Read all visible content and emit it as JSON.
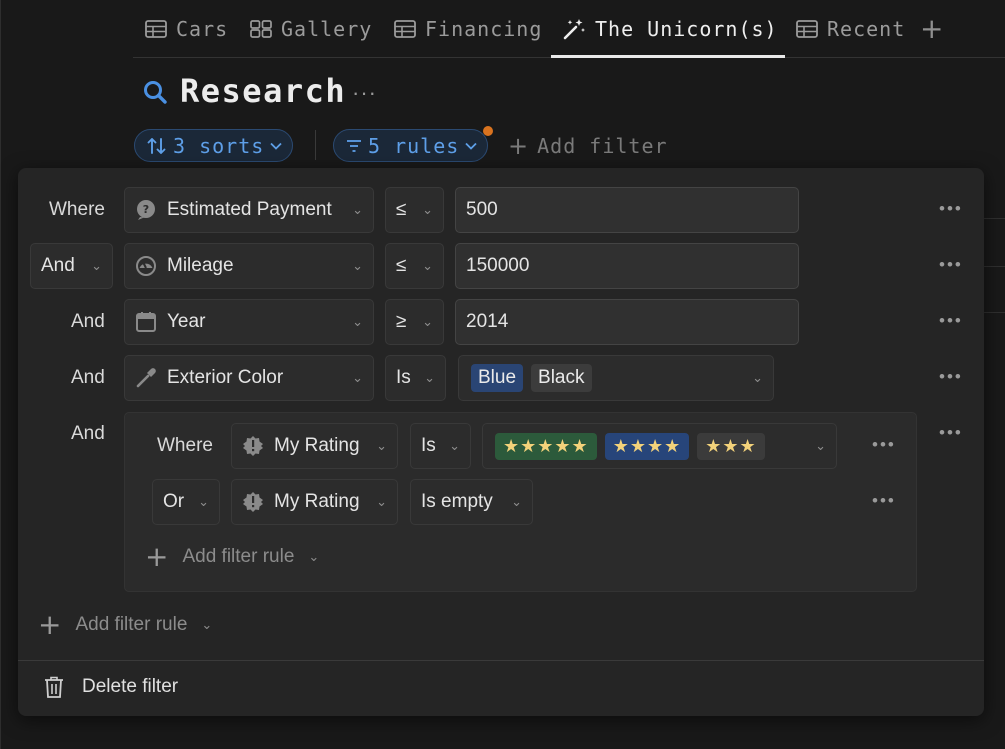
{
  "tabs": [
    {
      "label": "Cars",
      "icon": "table-icon"
    },
    {
      "label": "Gallery",
      "icon": "gallery-icon"
    },
    {
      "label": "Financing",
      "icon": "table-icon"
    },
    {
      "label": "The Unicorn(s)",
      "icon": "magic-wand-icon",
      "active": true
    },
    {
      "label": "Recent",
      "icon": "table-icon"
    }
  ],
  "tab_add": "+",
  "page": {
    "title": "Research",
    "more": "···"
  },
  "toolbar": {
    "sorts_label": "3 sorts",
    "rules_label": "5 rules",
    "add_filter_label": "Add filter"
  },
  "filter": {
    "rows": [
      {
        "conj": "Where",
        "property": "Estimated Payment",
        "operator": "≤",
        "value": "500"
      },
      {
        "conj": "And",
        "property": "Mileage",
        "operator": "≤",
        "value": "150000"
      },
      {
        "conj": "And",
        "property": "Year",
        "operator": "≥",
        "value": "2014"
      },
      {
        "conj": "And",
        "property": "Exterior Color",
        "operator": "Is",
        "tags": [
          "Blue",
          "Black"
        ]
      },
      {
        "conj": "And"
      }
    ],
    "group": {
      "rows": [
        {
          "conj": "Where",
          "property": "My Rating",
          "operator": "Is",
          "stars": [
            "★★★★★",
            "★★★★",
            "★★★"
          ]
        },
        {
          "conj": "Or",
          "property": "My Rating",
          "operator": "Is empty"
        }
      ],
      "add_rule_label": "Add filter rule"
    },
    "add_rule_label": "Add filter rule",
    "delete_label": "Delete filter"
  },
  "colors": {
    "accent": "#5e9fe8",
    "dot": "#d9731f",
    "background": "#191919",
    "panel": "#252525"
  }
}
